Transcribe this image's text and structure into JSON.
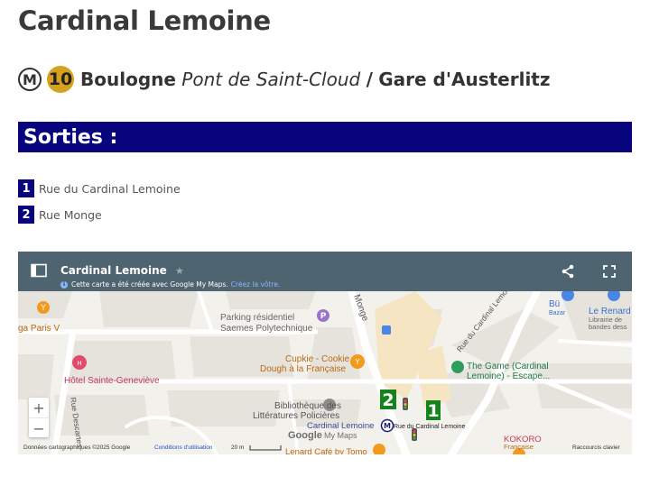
{
  "page": {
    "title": "Cardinal Lemoine"
  },
  "line": {
    "metro_symbol": "M",
    "number": "10",
    "badge_color": "#d5a21d",
    "terminus_1": "Boulogne",
    "terminus_1_detail": "Pont de Saint-Cloud",
    "separator": "/",
    "terminus_2": "Gare d'Austerlitz"
  },
  "exits": {
    "heading": "Sorties :",
    "header_color": "#08047e",
    "number_color": "#08047e",
    "items": [
      {
        "number": "1",
        "label": "Rue du Cardinal Lemoine"
      },
      {
        "number": "2",
        "label": "Rue Monge"
      }
    ]
  },
  "map": {
    "header_color": "#4e6571",
    "title": "Cardinal Lemoine",
    "star_icon": "star-icon",
    "subtitle": "Cette carte a été créée avec Google My Maps.",
    "subtitle_link": "Créez la vôtre.",
    "share_icon": "share-icon",
    "fullscreen_icon": "fullscreen-icon",
    "sidebar_icon": "sidebar-toggle-icon",
    "zoom_in": "+",
    "zoom_out": "−",
    "labels": {
      "paris": "ga Paris V",
      "parking_1": "Parking résidentiel",
      "parking_2": "Saemes Polytechnique",
      "monge": "Monge",
      "rue_cardinal": "Rue du Cardinal Lemoine",
      "bu": "Bü",
      "bazar": "Bazar",
      "lerenard_1": "Le Renard",
      "lerenard_2": "Librairie de",
      "lerenard_3": "bandes dess",
      "cupkie_1": "Cupkie - Cookie",
      "cupkie_2": "Dough à la Française",
      "hotel": "Hôtel Sainte-Geneviève",
      "thegame_1": "The Game (Cardinal",
      "thegame_2": "Lemoine) - Escape...",
      "biblio_1": "Bibliothèque des",
      "biblio_2": "Littératures Policières",
      "rue_descartes": "Rue Descartes",
      "station": "Cardinal Lemoine",
      "exit_label": "Rue du Cardinal Lemoine",
      "kokoro_1": "KOKORO",
      "kokoro_2": "Française",
      "renard_cafe": "Lenard Café by Tomo",
      "google_logo": "Google",
      "my_maps": "My Maps",
      "exit_1": "1",
      "exit_2": "2",
      "metro_symbol": "M"
    },
    "footer": {
      "copyright": "Données cartographiques ©2025 Google",
      "terms": "Conditions d'utilisation",
      "scale": "20 m",
      "shortcuts": "Raccourcis clavier"
    },
    "colors": {
      "land": "#f3f1ec",
      "block": "#e6e3dd",
      "road": "#ffffff",
      "poi_orange": "#f29a1e",
      "poi_purple": "#9a74c9",
      "poi_green": "#2e9e5b",
      "exit_green": "#16821b",
      "label_orange": "#b96a12",
      "label_green": "#1f7a4a",
      "label_pink": "#c0395c"
    }
  }
}
